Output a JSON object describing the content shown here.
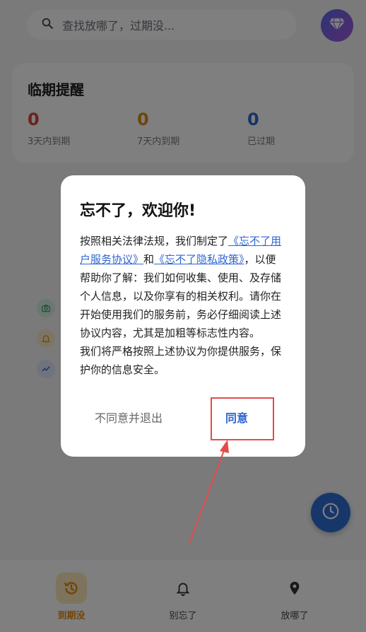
{
  "search": {
    "placeholder": "查找放哪了，过期没..."
  },
  "reminder": {
    "title": "临期提醒",
    "stats": [
      {
        "value": "0",
        "label": "3天内到期",
        "color": "#d9433a"
      },
      {
        "value": "0",
        "label": "7天内到期",
        "color": "#e08a10"
      },
      {
        "value": "0",
        "label": "已过期",
        "color": "#2f66d0"
      }
    ]
  },
  "dialog": {
    "title": "忘不了，欢迎你!",
    "body_p1_before": "按照相关法律法规，我们制定了",
    "link_user_agreement": "《忘不了用户服务协议》",
    "body_and": "和",
    "link_privacy": "《忘不了隐私政策》",
    "body_p1_after": "，以便帮助你了解：我们如何收集、使用、及存储个人信息，以及你享有的相关权利。请你在开始使用我们的服务前，务必仔细阅读上述协议内容，尤其是加粗等标志性内容。",
    "body_p2": "我们将严格按照上述协议为你提供服务，保护你的信息安全。",
    "decline_label": "不同意并退出",
    "agree_label": "同意"
  },
  "nav": {
    "items": [
      {
        "label": "到期没",
        "icon": "history-icon",
        "active": true
      },
      {
        "label": "别忘了",
        "icon": "bell-icon",
        "active": false
      },
      {
        "label": "放哪了",
        "icon": "location-pin-icon",
        "active": false
      }
    ]
  },
  "colors": {
    "accent": "#2f66d0",
    "warning": "#e08a10",
    "danger": "#d9433a",
    "annotation": "#e34b4b"
  }
}
